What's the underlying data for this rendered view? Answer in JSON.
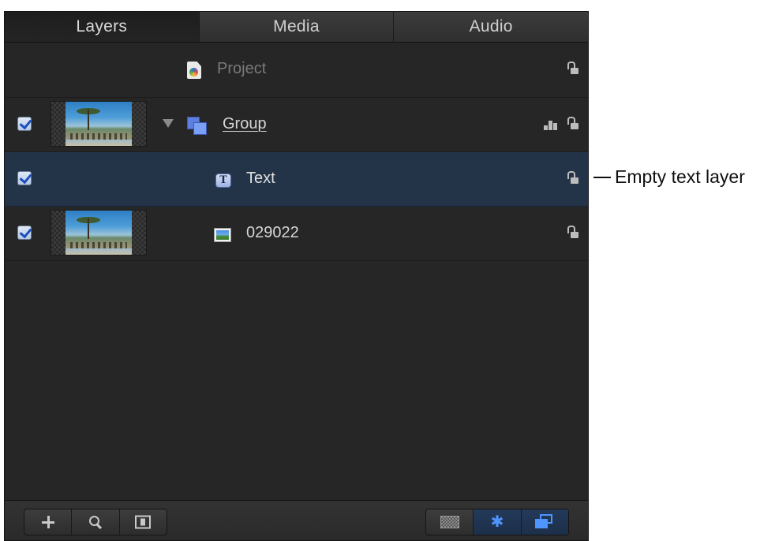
{
  "tabs": [
    {
      "label": "Layers",
      "active": true
    },
    {
      "label": "Media",
      "active": false
    },
    {
      "label": "Audio",
      "active": false
    }
  ],
  "layers": {
    "project": {
      "name": "Project",
      "icon": "project-icon"
    },
    "group": {
      "name": "Group",
      "icon": "group-icon",
      "checked": true,
      "expanded": true
    },
    "text": {
      "name": "Text",
      "icon": "text-layer-icon",
      "checked": true,
      "selected": true
    },
    "image": {
      "name": "029022",
      "icon": "image-layer-icon",
      "checked": true
    }
  },
  "bottom_bar": {
    "left_buttons": [
      "plus-icon",
      "search-icon",
      "isolate-icon"
    ],
    "right_buttons": [
      "checker-icon",
      "gear-icon",
      "layers-icon"
    ]
  },
  "callout": {
    "text": "Empty text layer"
  },
  "colors": {
    "panel_bg": "#262626",
    "selected_row": "#243448",
    "accent_blue": "#4f95ff"
  }
}
